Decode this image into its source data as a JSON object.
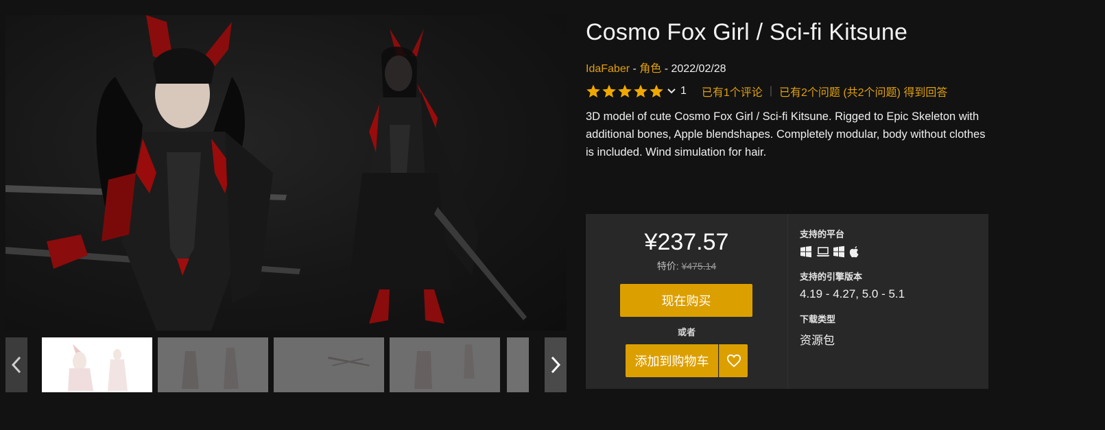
{
  "product": {
    "title": "Cosmo Fox Girl / Sci-fi Kitsune",
    "author": "IdaFaber",
    "category": "角色",
    "date": "2022/02/28",
    "separator": " - ",
    "rating_count": "1",
    "rating": 5,
    "reviews_link": "已有1个评论",
    "questions_link": "已有2个问题 (共2个问题) 得到回答",
    "description": "3D model of cute Cosmo Fox Girl / Sci-fi Kitsune. Rigged to Epic Skeleton with additional bones, Apple blendshapes. Completely modular, body without clothes is included. Wind simulation for hair."
  },
  "purchase": {
    "price": "¥237.57",
    "sale_label": "特价:",
    "original_price": "¥475.14",
    "buy_now_label": "现在购买",
    "or_label": "或者",
    "add_to_cart_label": "添加到购物车"
  },
  "specs": {
    "platforms_label": "支持的平台",
    "platform_icons": [
      "windows-icon",
      "laptop-icon",
      "windows-icon",
      "apple-icon"
    ],
    "engine_label": "支持的引擎版本",
    "engine_versions": "4.19 - 4.27, 5.0 - 5.1",
    "download_label": "下载类型",
    "download_type": "资源包"
  },
  "gallery": {
    "thumbnail_count": 5
  },
  "colors": {
    "accent": "#dc9f00",
    "link": "#e0a010",
    "star": "#f0a800",
    "background": "#121212",
    "panel": "#282828"
  }
}
